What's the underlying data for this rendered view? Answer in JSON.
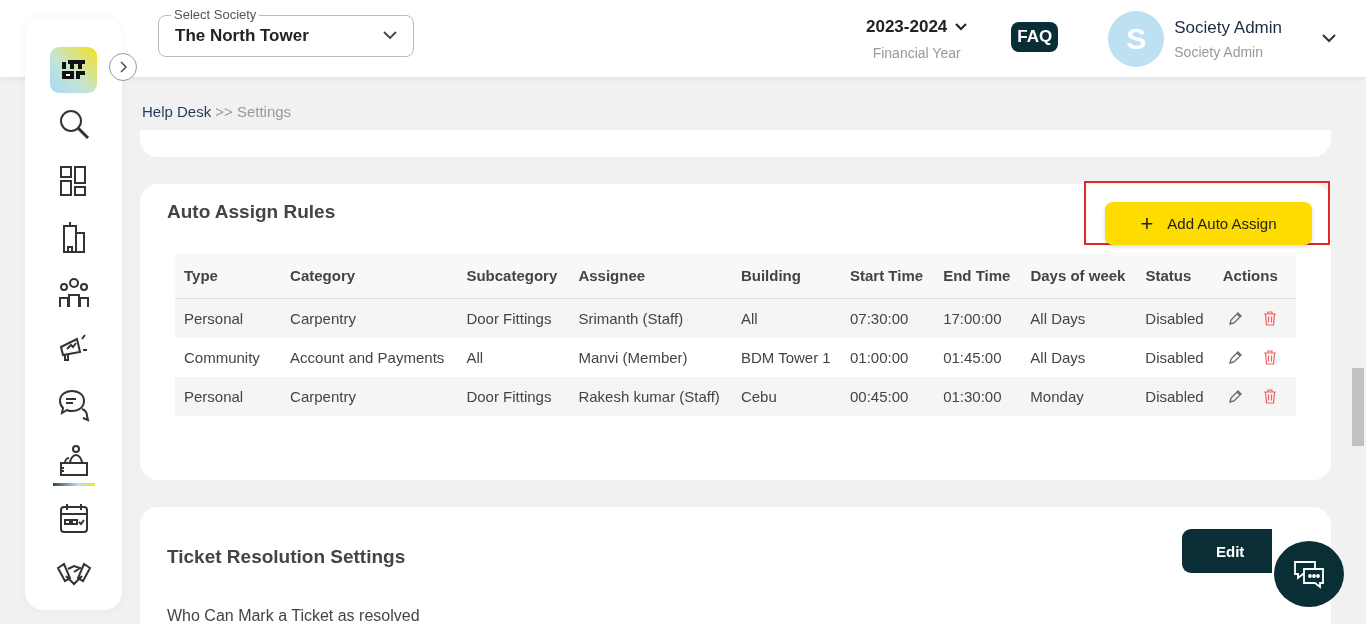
{
  "sidebar": {
    "items": [
      {
        "kind": "search",
        "selected": false
      },
      {
        "kind": "grid",
        "selected": false
      },
      {
        "kind": "building",
        "selected": false
      },
      {
        "kind": "people",
        "selected": false
      },
      {
        "kind": "megaphone",
        "selected": false
      },
      {
        "kind": "chat",
        "selected": false
      },
      {
        "kind": "helpdesk",
        "selected": true
      },
      {
        "kind": "calendar",
        "selected": false
      },
      {
        "kind": "handshake",
        "selected": false
      }
    ]
  },
  "header": {
    "society_select": {
      "label": "Select Society",
      "value": "The North Tower"
    },
    "financial_year": {
      "value": "2023-2024",
      "label": "Financial Year"
    },
    "faq": "FAQ",
    "user": {
      "initial": "S",
      "name": "Society Admin",
      "role": "Society Admin"
    }
  },
  "breadcrumb": {
    "parent": "Help Desk",
    "separator": ">>",
    "current": "Settings"
  },
  "auto_assign": {
    "title": "Auto Assign Rules",
    "add_button": "Add Auto Assign",
    "add_icon": "+",
    "highlighted": true,
    "table": {
      "columns": [
        "Type",
        "Category",
        "Subcategory",
        "Assignee",
        "Building",
        "Start Time",
        "End Time",
        "Days of week",
        "Status",
        "Actions"
      ],
      "rows": [
        {
          "cells": [
            "Personal",
            "Carpentry",
            "Door Fittings",
            "Srimanth (Staff)",
            "All",
            "07:30:00",
            "17:00:00",
            "All Days",
            "Disabled"
          ]
        },
        {
          "cells": [
            "Community",
            "Account and Payments",
            "All",
            "Manvi (Member)",
            "BDM Tower 1",
            "01:00:00",
            "01:45:00",
            "All Days",
            "Disabled"
          ]
        },
        {
          "cells": [
            "Personal",
            "Carpentry",
            "Door Fittings",
            "Rakesh kumar (Staff)",
            "Cebu",
            "00:45:00",
            "01:30:00",
            "Monday",
            "Disabled"
          ]
        }
      ]
    }
  },
  "ticket_resolution": {
    "title": "Ticket Resolution Settings",
    "edit_button": "Edit",
    "question": "Who Can Mark a Ticket as resolved"
  }
}
